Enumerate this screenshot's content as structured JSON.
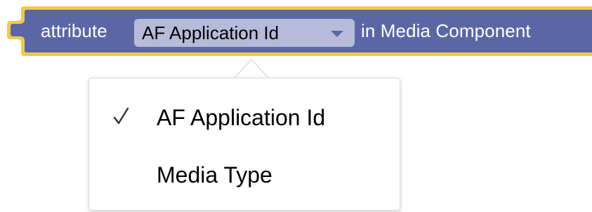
{
  "block": {
    "label_prefix": "attribute",
    "label_suffix": "in Media Component",
    "colors": {
      "fill": "#5b67a5",
      "border": "#f2c94c",
      "field_fill": "#b7bad8"
    }
  },
  "field": {
    "selected_value": "AF Application Id",
    "arrow_icon": "chevron-down-icon"
  },
  "dropdown": {
    "items": [
      {
        "label": "AF Application Id",
        "checked": true,
        "check_icon": "checkmark-icon"
      },
      {
        "label": "Media Type",
        "checked": false
      }
    ]
  }
}
